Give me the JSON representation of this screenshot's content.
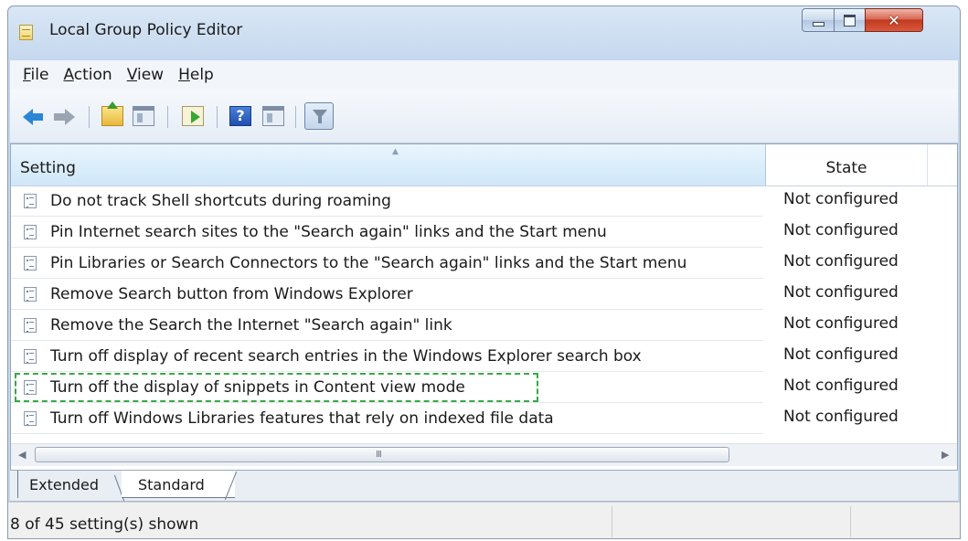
{
  "window": {
    "title": "Local Group Policy Editor"
  },
  "menu": [
    {
      "label_u": "F",
      "label_rest": "ile"
    },
    {
      "label_u": "A",
      "label_rest": "ction"
    },
    {
      "label_u": "V",
      "label_rest": "iew"
    },
    {
      "label_u": "H",
      "label_rest": "elp"
    }
  ],
  "toolbar": {
    "help_glyph": "?",
    "icons": [
      "back-arrow-icon",
      "forward-arrow-icon",
      "up-folder-icon",
      "show-hide-pane-icon",
      "export-list-icon",
      "help-icon",
      "action-pane-icon",
      "filter-icon"
    ]
  },
  "list": {
    "columns": {
      "setting": "Setting",
      "state": "State"
    },
    "sort_glyph": "▲",
    "rows": [
      {
        "setting": "Do not track Shell shortcuts during roaming",
        "state": "Not configured"
      },
      {
        "setting": "Pin Internet search sites to the \"Search again\" links and the Start menu",
        "state": "Not configured"
      },
      {
        "setting": "Pin Libraries or Search Connectors to the \"Search again\" links and the Start menu",
        "state": "Not configured"
      },
      {
        "setting": "Remove Search button from Windows Explorer",
        "state": "Not configured"
      },
      {
        "setting": "Remove the Search the Internet \"Search again\" link",
        "state": "Not configured"
      },
      {
        "setting": "Turn off display of recent search entries in the Windows Explorer search box",
        "state": "Not configured"
      },
      {
        "setting": "Turn off the display of snippets in Content view mode",
        "state": "Not configured"
      },
      {
        "setting": "Turn off Windows Libraries features that rely on indexed file data",
        "state": "Not configured"
      }
    ],
    "highlighted_row_index": 6,
    "highlight_color": "#3aa845"
  },
  "scrollbar": {
    "left_glyph": "◀",
    "right_glyph": "▶",
    "grip": "III"
  },
  "tabs": [
    {
      "label": "Extended",
      "selected": false
    },
    {
      "label": "Standard",
      "selected": true
    }
  ],
  "status": {
    "text": "8 of 45 setting(s) shown"
  },
  "colors": {
    "accent_blue": "#2a86d6",
    "close_red": "#c13a20"
  }
}
